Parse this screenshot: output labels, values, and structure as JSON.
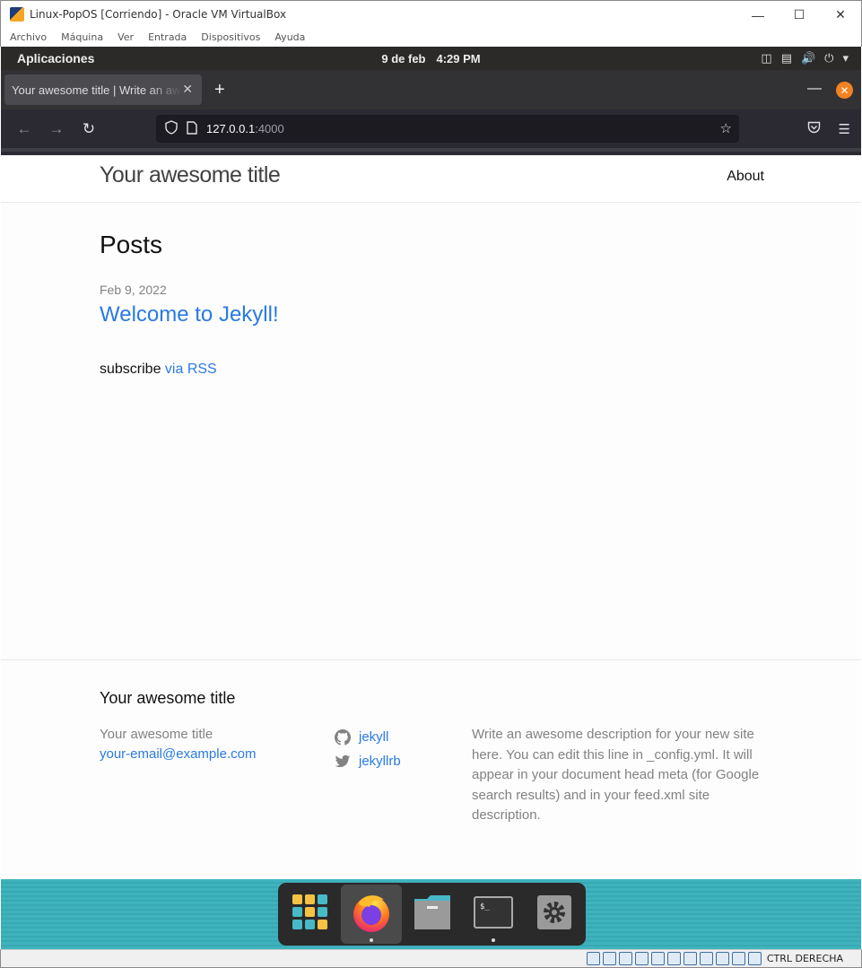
{
  "vbox": {
    "window_title": "Linux-PopOS [Corriendo] - Oracle VM VirtualBox",
    "menu": [
      "Archivo",
      "Máquina",
      "Ver",
      "Entrada",
      "Dispositivos",
      "Ayuda"
    ],
    "host_key": "CTRL DERECHA"
  },
  "gnome": {
    "apps_label": "Aplicaciones",
    "date": "9 de feb",
    "time": "4:29 PM"
  },
  "firefox": {
    "tab_title": "Your awesome title | Write an awesome description",
    "url_host": "127.0.0.1",
    "url_port": ":4000"
  },
  "site": {
    "title": "Your awesome title",
    "nav_about": "About",
    "heading": "Posts",
    "post_date": "Feb 9, 2022",
    "post_title": "Welcome to Jekyll!",
    "subscribe_text": "subscribe ",
    "rss_link": "via RSS",
    "footer": {
      "heading": "Your awesome title",
      "name": "Your awesome title",
      "email": "your-email@example.com",
      "github": "jekyll",
      "twitter": "jekyllrb",
      "description": "Write an awesome description for your new site here. You can edit this line in _config.yml. It will appear in your document head meta (for Google search results) and in your feed.xml site description."
    }
  },
  "dock": {
    "items": [
      "app-grid-icon",
      "firefox-icon",
      "files-icon",
      "terminal-icon",
      "settings-icon"
    ]
  }
}
